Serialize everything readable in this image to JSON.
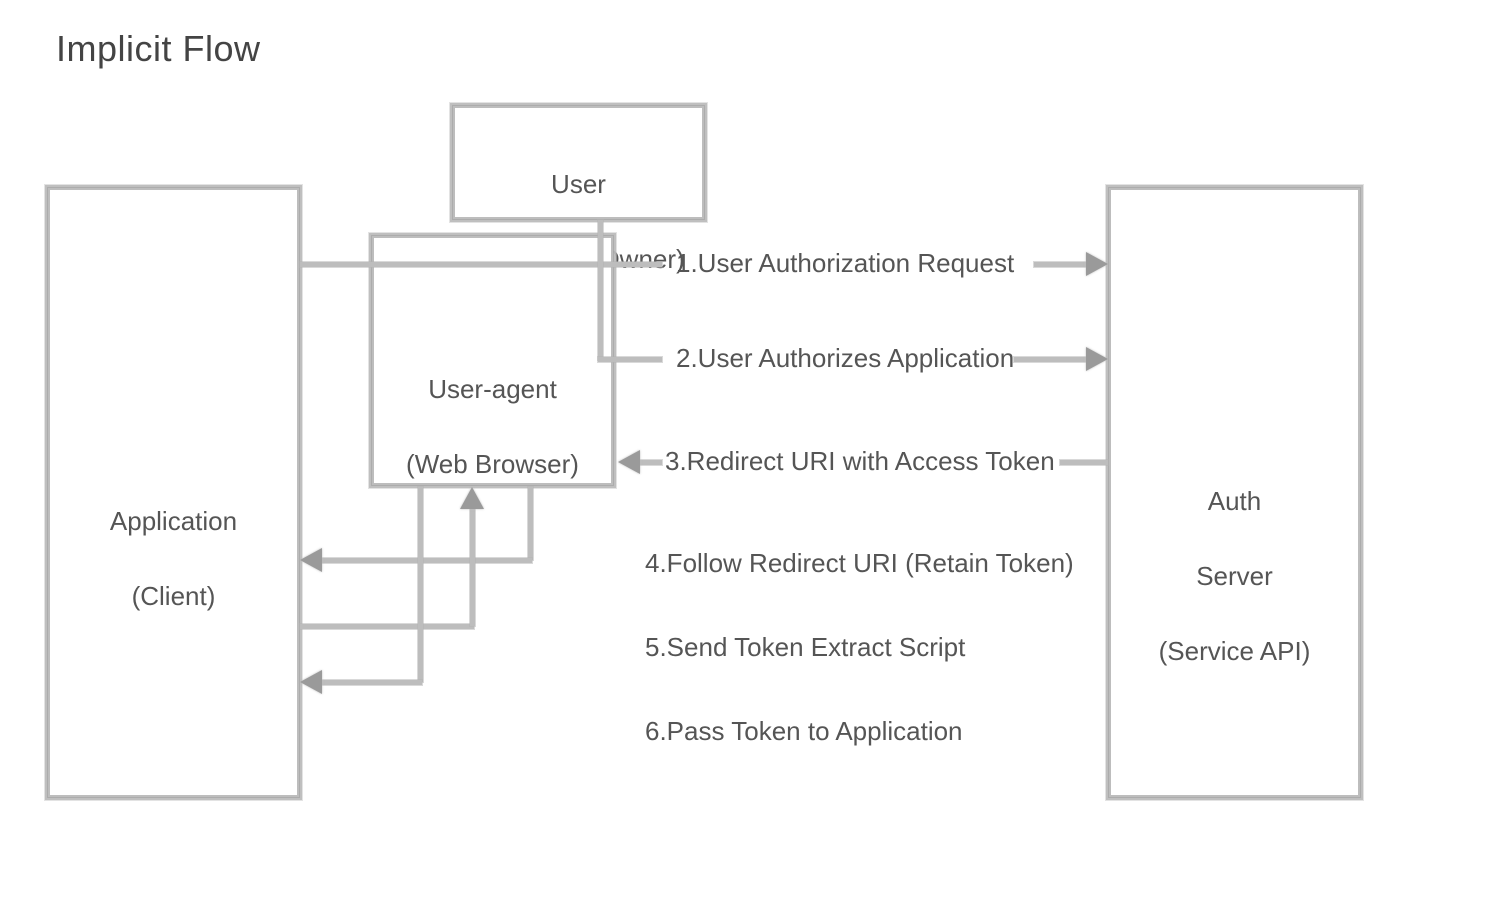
{
  "title": "Implicit Flow",
  "nodes": {
    "application": {
      "line1": "Application",
      "line2": "(Client)"
    },
    "user": {
      "line1": "User",
      "line2": "(Resource Owner)"
    },
    "user_agent": {
      "line1": "User-agent",
      "line2": "(Web Browser)"
    },
    "auth_server": {
      "line1": "Auth",
      "line2": "Server",
      "line3": "(Service API)"
    }
  },
  "steps": {
    "s1": "1.User Authorization Request",
    "s2": "2.User Authorizes Application",
    "s3": "3.Redirect URI with Access Token",
    "s4": "4.Follow Redirect URI (Retain Token)",
    "s5": "5.Send Token Extract Script",
    "s6": "6.Pass Token to Application"
  }
}
